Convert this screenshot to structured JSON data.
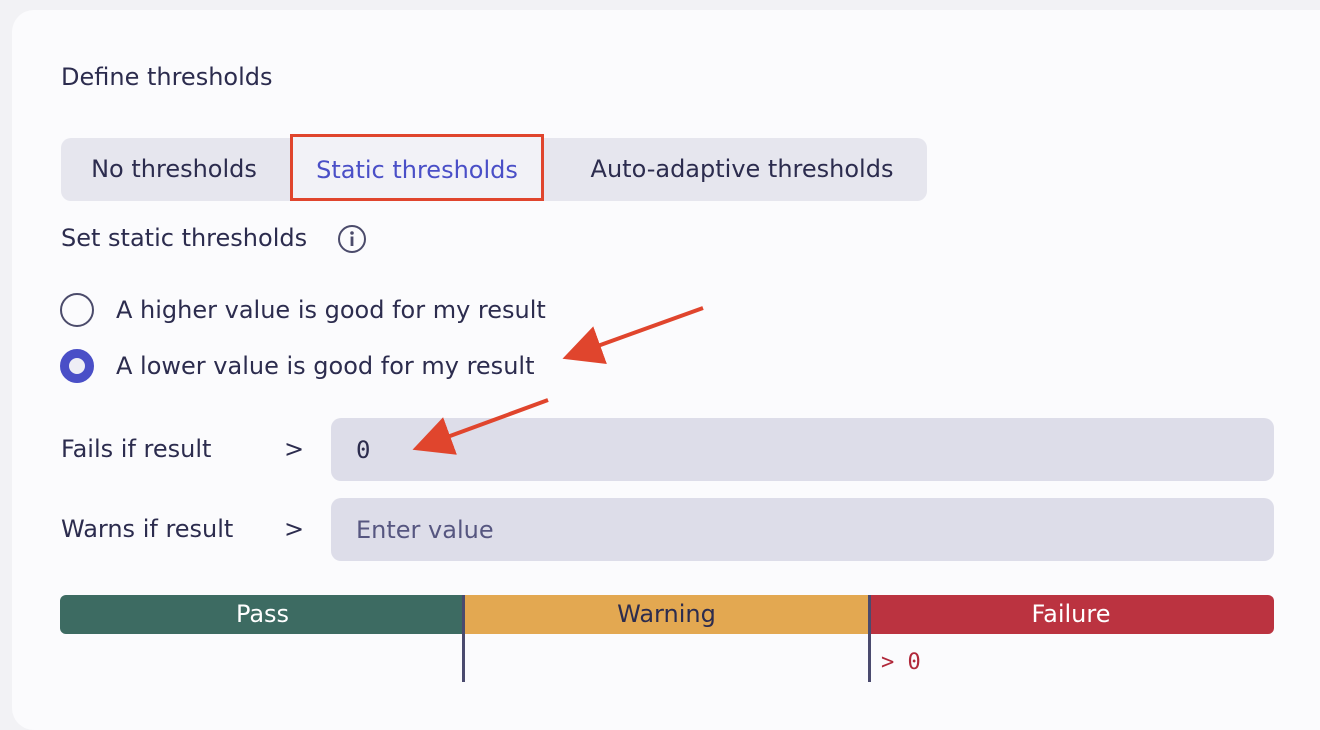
{
  "section": {
    "title": "Define thresholds",
    "tabs": [
      {
        "label": "No thresholds",
        "selected": false
      },
      {
        "label": "Static thresholds",
        "selected": true
      },
      {
        "label": "Auto-adaptive thresholds",
        "selected": false
      }
    ]
  },
  "static": {
    "subtitle": "Set static thresholds",
    "info_icon": "info-circle-icon",
    "options": [
      {
        "label": "A higher value is good for my result",
        "checked": false
      },
      {
        "label": "A lower value is good for my result",
        "checked": true
      }
    ],
    "fails": {
      "label": "Fails if result",
      "operator": ">",
      "value": "0",
      "placeholder": ""
    },
    "warns": {
      "label": "Warns if result",
      "operator": ">",
      "value": "",
      "placeholder": "Enter value"
    }
  },
  "scale": {
    "pass": "Pass",
    "warning": "Warning",
    "failure": "Failure",
    "failure_marker": "> 0",
    "colors": {
      "pass": "#3d6b62",
      "warning": "#e3a851",
      "failure": "#bb3340"
    }
  },
  "annotations": {
    "highlight_color": "#e0452d",
    "arrow_color": "#e0452d"
  }
}
